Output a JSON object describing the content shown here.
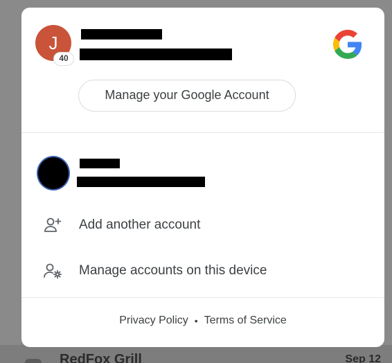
{
  "account_menu": {
    "primary_account": {
      "avatar_initial": "J",
      "notification_count": "40",
      "manage_button_label": "Manage your Google Account"
    },
    "actions": [
      {
        "label": "Add another account",
        "icon": "add-person-icon"
      },
      {
        "label": "Manage accounts on this device",
        "icon": "manage-accounts-icon"
      }
    ],
    "footer": {
      "privacy_label": "Privacy Policy",
      "separator": "•",
      "terms_label": "Terms of Service"
    }
  },
  "background": {
    "item_title": "RedFox Grill",
    "item_date": "Sep 12"
  },
  "colors": {
    "avatar_primary": "#c9543a",
    "avatar_secondary_ring": "#3b5fb0",
    "google_blue": "#4285F4",
    "google_red": "#EA4335",
    "google_yellow": "#FBBC05",
    "google_green": "#34A853"
  }
}
